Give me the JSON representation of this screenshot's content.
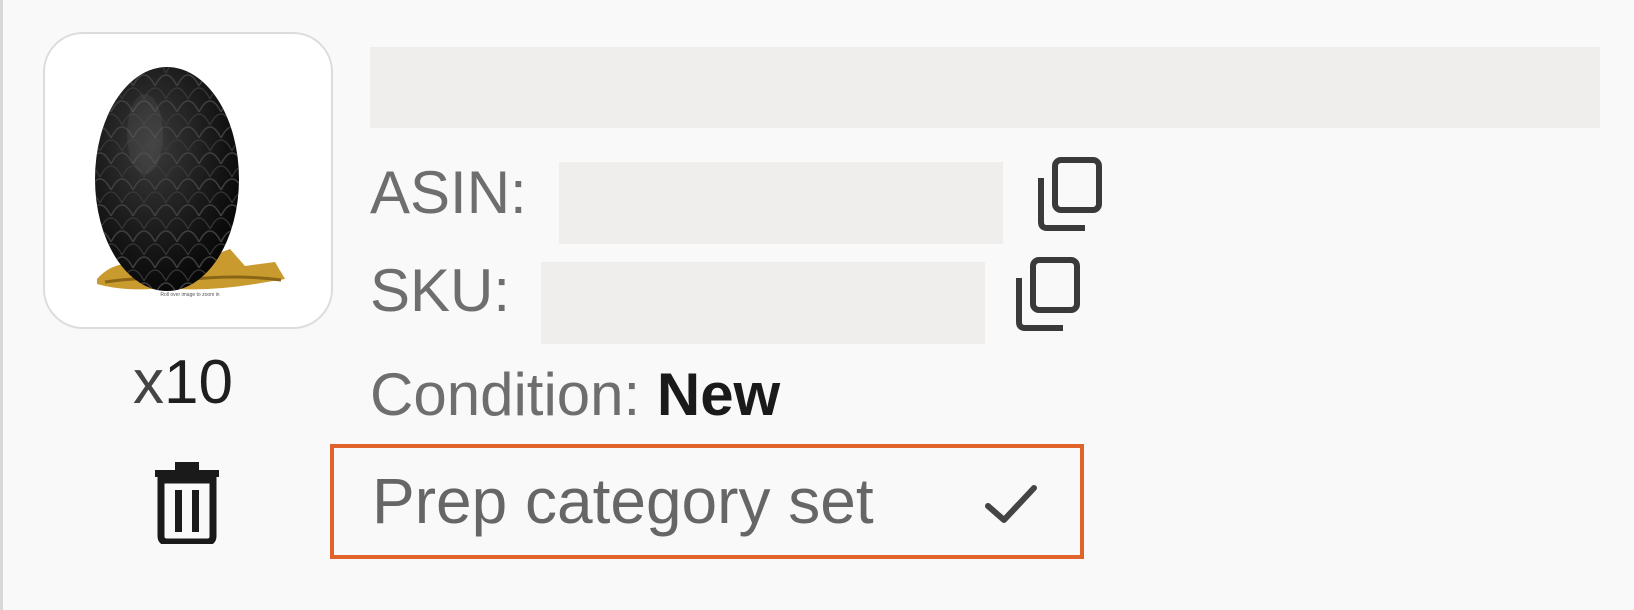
{
  "product": {
    "image_alt": "black dragon egg with gold dragon",
    "image_caption": "Roll over image to zoom in",
    "quantity_prefix": "x",
    "quantity_value": "10"
  },
  "details": {
    "asin_label": "ASIN:",
    "sku_label": "SKU:",
    "condition_label": "Condition:",
    "condition_value": "New"
  },
  "prep": {
    "label": "Prep category set"
  },
  "icons": {
    "copy": "copy-icon",
    "trash": "trash-icon",
    "check": "check-icon"
  },
  "colors": {
    "highlight_border": "#e0632c",
    "redaction": "#efeeec"
  }
}
